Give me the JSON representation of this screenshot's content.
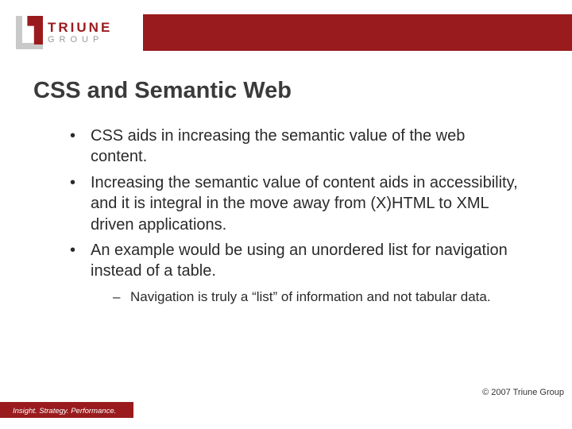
{
  "logo": {
    "line1": "TRIUNE",
    "line2": "GROUP"
  },
  "title": "CSS and Semantic Web",
  "bullets": [
    "CSS aids in increasing the semantic value of the web content.",
    "Increasing the semantic value of content aids in accessibility, and it is integral in the move away from (X)HTML to XML driven applications.",
    "An example would be using an unordered list for navigation instead of a table."
  ],
  "sub_bullets": [
    "Navigation is truly a “list” of information and not tabular data."
  ],
  "copyright": "© 2007 Triune Group",
  "tagline": "Insight. Strategy. Performance."
}
